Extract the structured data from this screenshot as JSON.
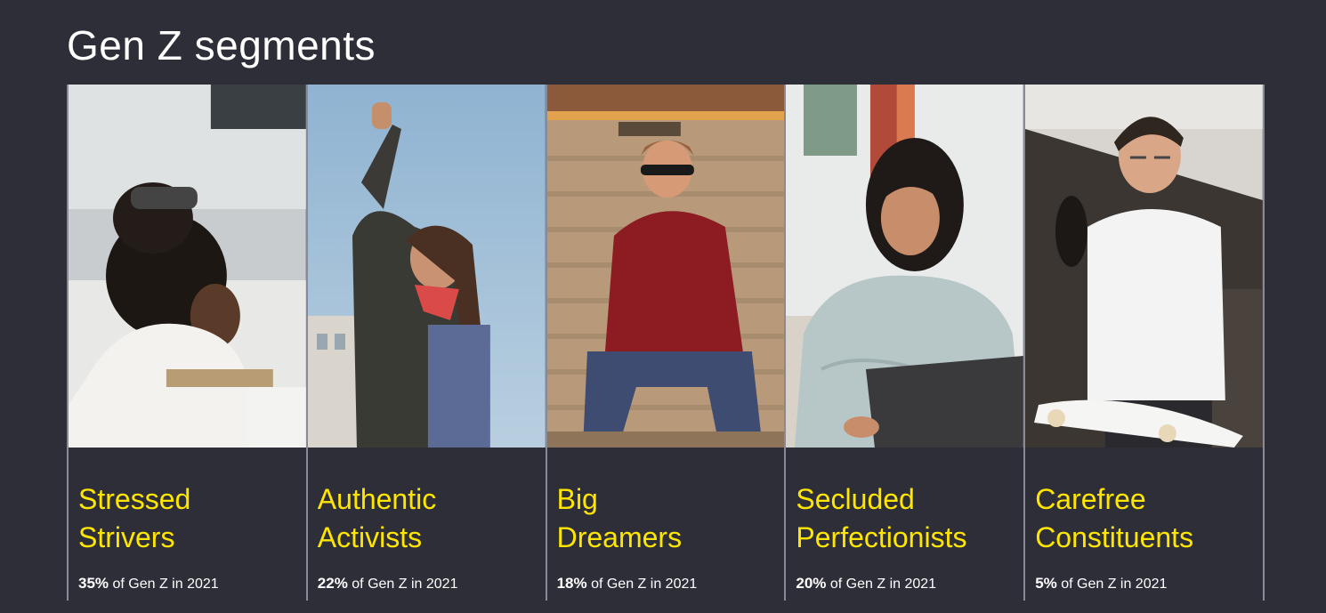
{
  "page": {
    "title": "Gen Z segments"
  },
  "colors": {
    "background": "#2e2e38",
    "accent": "#ffe600",
    "divider": "#8a8a96",
    "text": "#ffffff"
  },
  "segments": [
    {
      "name_line1": "Stressed",
      "name_line2": "Strivers",
      "percent": "35%",
      "stat_text": " of Gen Z in 2021",
      "photo": "student-studying-photo"
    },
    {
      "name_line1": "Authentic",
      "name_line2": "Activists",
      "percent": "22%",
      "stat_text": " of Gen Z in 2021",
      "photo": "raised-fist-protester-photo"
    },
    {
      "name_line1": "Big",
      "name_line2": "Dreamers",
      "percent": "18%",
      "stat_text": " of Gen Z in 2021",
      "photo": "young-man-sunglasses-photo"
    },
    {
      "name_line1": "Secluded",
      "name_line2": "Perfectionists",
      "percent": "20%",
      "stat_text": " of Gen Z in 2021",
      "photo": "woman-laptop-photo"
    },
    {
      "name_line1": "Carefree",
      "name_line2": "Constituents",
      "percent": "5%",
      "stat_text": " of Gen Z in 2021",
      "photo": "smiling-skateboarder-photo"
    }
  ]
}
